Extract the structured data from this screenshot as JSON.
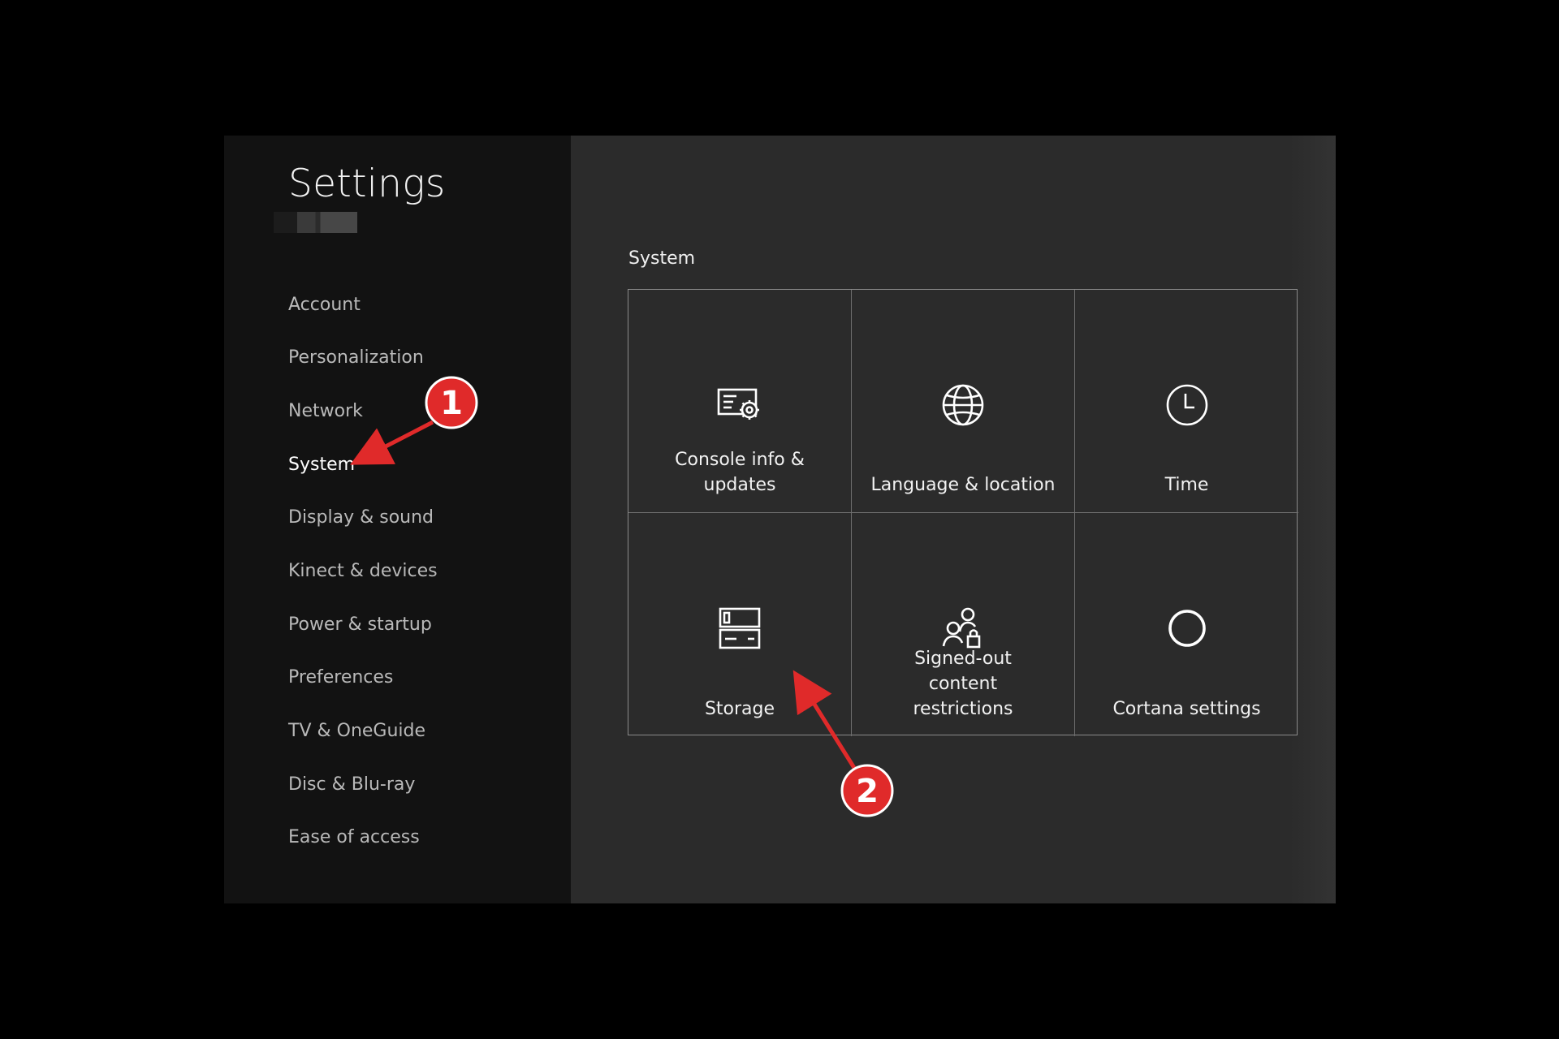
{
  "sidebar": {
    "title": "Settings",
    "items": [
      {
        "label": "Account"
      },
      {
        "label": "Personalization"
      },
      {
        "label": "Network"
      },
      {
        "label": "System"
      },
      {
        "label": "Display & sound"
      },
      {
        "label": "Kinect & devices"
      },
      {
        "label": "Power & startup"
      },
      {
        "label": "Preferences"
      },
      {
        "label": "TV & OneGuide"
      },
      {
        "label": "Disc & Blu-ray"
      },
      {
        "label": "Ease of access"
      }
    ],
    "active_item": "System"
  },
  "main": {
    "section_title": "System",
    "tiles": [
      {
        "label": "Console info & updates",
        "icon": "console-info-icon"
      },
      {
        "label": "Language & location",
        "icon": "globe-icon"
      },
      {
        "label": "Time",
        "icon": "clock-icon"
      },
      {
        "label": "Storage",
        "icon": "storage-icon"
      },
      {
        "label": "Signed-out content restrictions",
        "icon": "users-lock-icon"
      },
      {
        "label": "Cortana settings",
        "icon": "cortana-circle-icon"
      }
    ]
  },
  "annotations": {
    "step1": "1",
    "step2": "2"
  },
  "colors": {
    "accent": "#e02a2a",
    "sidebar_bg": "#121212",
    "content_bg": "#2b2b2b",
    "tile_border": "#8a8a8a"
  }
}
